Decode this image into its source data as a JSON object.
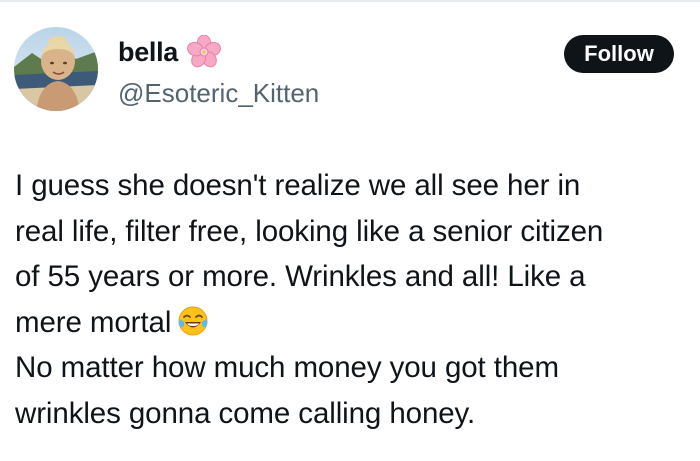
{
  "tweet": {
    "author": {
      "display_name": "bella",
      "name_emoji": "cherry-blossom-icon",
      "handle": "@Esoteric_Kitten",
      "avatar": "avatar-photo"
    },
    "follow_label": "Follow",
    "text_lines": [
      "I guess she doesn't realize we all see her in",
      "real life, filter free,  looking like a senior citizen",
      "of 55 years or more. Wrinkles and all! Like a",
      "mere mortal",
      "No matter how much money you got them",
      "wrinkles gonna come calling honey."
    ],
    "inline_emoji": "tears-of-joy-icon"
  },
  "colors": {
    "text": "#0f1419",
    "handle": "#536471",
    "button_bg": "#0f1419",
    "button_text": "#ffffff",
    "flower": "#f7a8c4"
  }
}
